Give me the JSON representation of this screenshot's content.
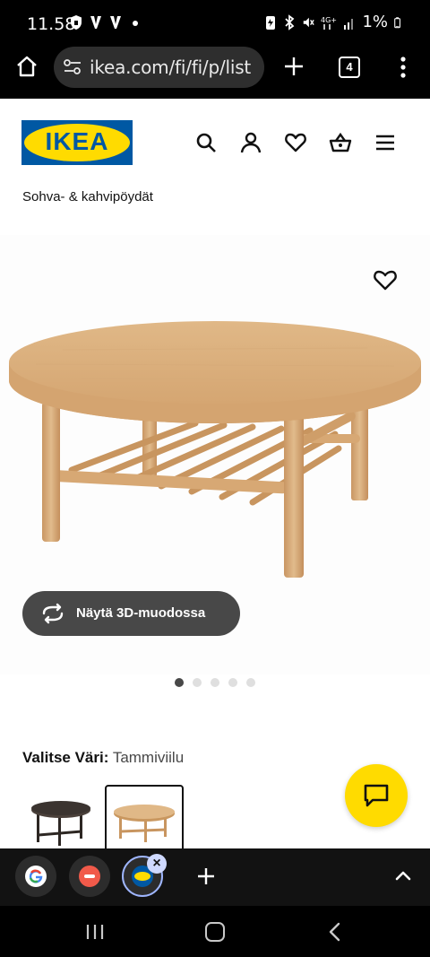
{
  "status_bar": {
    "time": "11.58",
    "battery": "1%",
    "icons": [
      "shield-icon",
      "v-icon",
      "v-icon",
      "dot-icon",
      "battery-saver-icon",
      "bluetooth-icon",
      "mute-icon",
      "4g-icon",
      "signal-icon",
      "battery-icon"
    ]
  },
  "browser": {
    "url": "ikea.com/fi/fi/p/list",
    "tab_count": "4"
  },
  "header": {
    "logo_text": "IKEA",
    "icons": [
      "search-icon",
      "user-icon",
      "heart-icon",
      "basket-icon",
      "hamburger-menu-icon"
    ]
  },
  "breadcrumb": "Sohva- & kahvipöydät",
  "product": {
    "view_3d_label": "Näytä 3D-muodossa",
    "image_count": 5,
    "active_image": 1,
    "color_label": "Valitse Väri:",
    "color_value": "Tammiviilu",
    "swatches": [
      {
        "name": "dark-brown",
        "color": "#3b3430",
        "selected": false
      },
      {
        "name": "oak",
        "color": "#d8ae7e",
        "selected": true
      }
    ]
  },
  "colors": {
    "ikea_blue": "#0058a3",
    "ikea_yellow": "#ffdb00",
    "wood": "#d9b07e",
    "button_dark": "#484848"
  },
  "tab_strip": {
    "tabs": [
      "google-tab",
      "tori-tab",
      "ikea-tab"
    ],
    "active_tab": "ikea-tab"
  }
}
